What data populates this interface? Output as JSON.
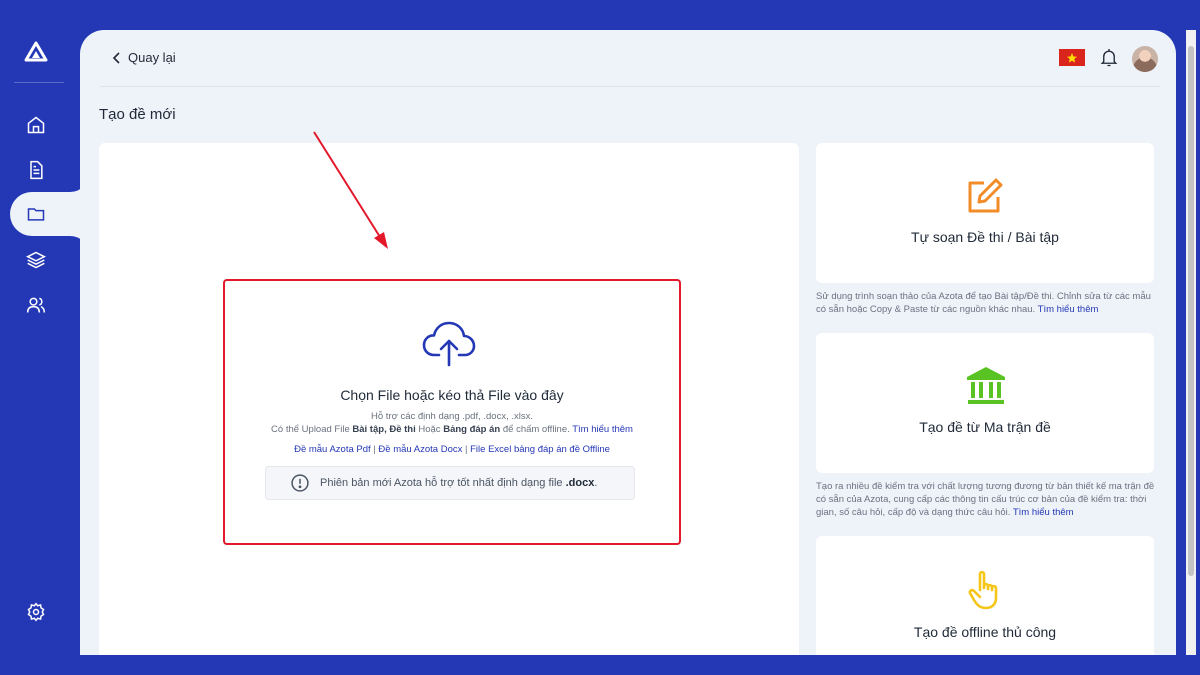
{
  "header": {
    "back_label": "Quay lại"
  },
  "page": {
    "title": "Tạo đề mới"
  },
  "upload": {
    "title": "Chọn File hoặc kéo thả File vào đây",
    "formats": "Hỗ trợ các định dạng .pdf, .docx, .xlsx.",
    "line2_prefix": "Có thể Upload File ",
    "line2_bold1": "Bài tập",
    "line2_sep": ", ",
    "line2_bold2": "Đề thi",
    "line2_mid": " Hoặc ",
    "line2_bold3": "Bảng đáp án",
    "line2_suffix": " để chấm offline. ",
    "learn_more": "Tìm hiểu thêm",
    "template_pdf": "Đề mẫu Azota Pdf",
    "template_docx": "Đề mẫu Azota Docx",
    "template_excel": "File Excel bảng đáp án đề Offline",
    "link_sep": " | ",
    "notice_text": "Phiên bản mới Azota hỗ trợ tốt nhất định dạng file ",
    "notice_bold": ".docx",
    "notice_end": "."
  },
  "options": [
    {
      "title": "Tự soạn Đề thi / Bài tập",
      "description": "Sử dụng trình soạn thảo của Azota để tạo Bài tập/Đề thi. Chỉnh sửa từ các mẫu có sẵn hoặc Copy & Paste từ các nguồn khác nhau. ",
      "learn_more": "Tìm hiểu thêm",
      "icon": "edit-icon",
      "color": "#f28c28"
    },
    {
      "title": "Tạo đề từ Ma trận đề",
      "description": "Tạo ra nhiều đề kiểm tra với chất lượng tương đương từ bản thiết kế ma trận đề có sẵn của Azota, cung cấp các thông tin cấu trúc cơ bản của đề kiểm tra: thời gian, số câu hỏi, cấp độ và dạng thức câu hỏi. ",
      "learn_more": "Tìm hiểu thêm",
      "icon": "bank-icon",
      "color": "#58c322"
    },
    {
      "title": "Tạo đề offline thủ công",
      "icon": "pointer-hand-icon",
      "color": "#f5c518"
    }
  ],
  "sidebar": {
    "items": [
      "home-icon",
      "document-icon",
      "folder-icon",
      "layers-icon",
      "users-icon"
    ],
    "active": "folder-icon",
    "settings": "gear-icon"
  },
  "colors": {
    "brand": "#2438b5",
    "background": "#eef2f9",
    "highlight": "#e3192b"
  }
}
